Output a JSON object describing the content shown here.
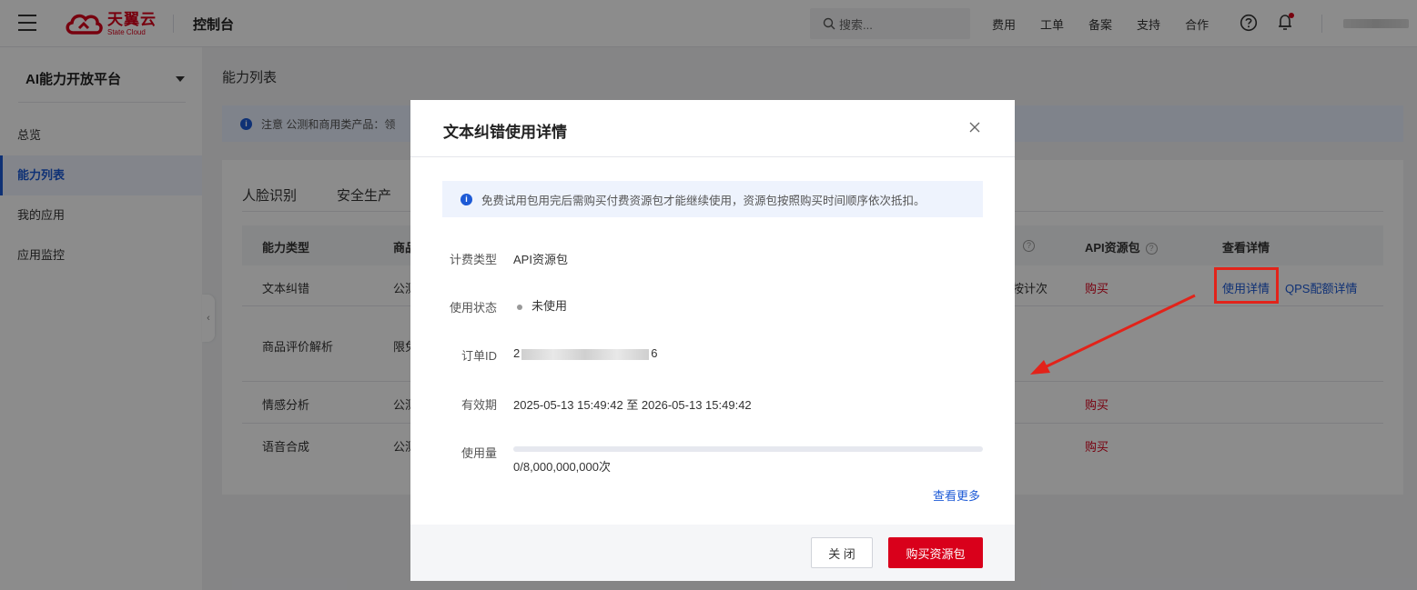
{
  "topbar": {
    "brand_cn": "天翼云",
    "brand_en": "State Cloud",
    "console_title": "控制台",
    "search_placeholder": "搜索...",
    "nav_links": [
      "费用",
      "工单",
      "备案",
      "支持",
      "合作"
    ]
  },
  "sidebar": {
    "title": "AI能力开放平台",
    "items": [
      {
        "label": "总览"
      },
      {
        "label": "能力列表"
      },
      {
        "label": "我的应用"
      },
      {
        "label": "应用监控"
      }
    ]
  },
  "main": {
    "page_title": "能力列表",
    "notice": "注意 公测和商用类产品：领",
    "tabs": [
      "人脸识别",
      "安全生产"
    ],
    "table": {
      "headers": {
        "type": "能力类型",
        "prod": "商品",
        "api_pkg": "API资源包",
        "details": "查看详情"
      },
      "rows": [
        {
          "type": "文本纠错",
          "prod": "公测",
          "billing": "按计次",
          "buy": "购买",
          "detail": "使用详情",
          "qps": "QPS配额详情"
        },
        {
          "type": "商品评价解析",
          "prod": "限免"
        },
        {
          "type": "情感分析",
          "prod": "公测",
          "buy": "购买"
        },
        {
          "type": "语音合成",
          "prod": "公测",
          "buy": "购买"
        }
      ]
    }
  },
  "modal": {
    "title": "文本纠错使用详情",
    "tip": "免费试用包用完后需购买付费资源包才能继续使用，资源包按照购买时间顺序依次抵扣。",
    "fields": {
      "billing_type_label": "计费类型",
      "billing_type_value": "API资源包",
      "status_label": "使用状态",
      "status_value": "未使用",
      "order_id_label": "订单ID",
      "order_id_prefix": "2",
      "order_id_suffix": "6",
      "validity_label": "有效期",
      "validity_value": "2025-05-13 15:49:42 至 2026-05-13 15:49:42",
      "usage_label": "使用量",
      "usage_value": "0/8,000,000,000次",
      "usage_fraction": 0
    },
    "more_link": "查看更多",
    "close_button": "关 闭",
    "buy_button": "购买资源包"
  },
  "colors": {
    "brand_red": "#d9001b",
    "link_blue": "#1d5ad6",
    "annotation_red": "#e2231a"
  }
}
